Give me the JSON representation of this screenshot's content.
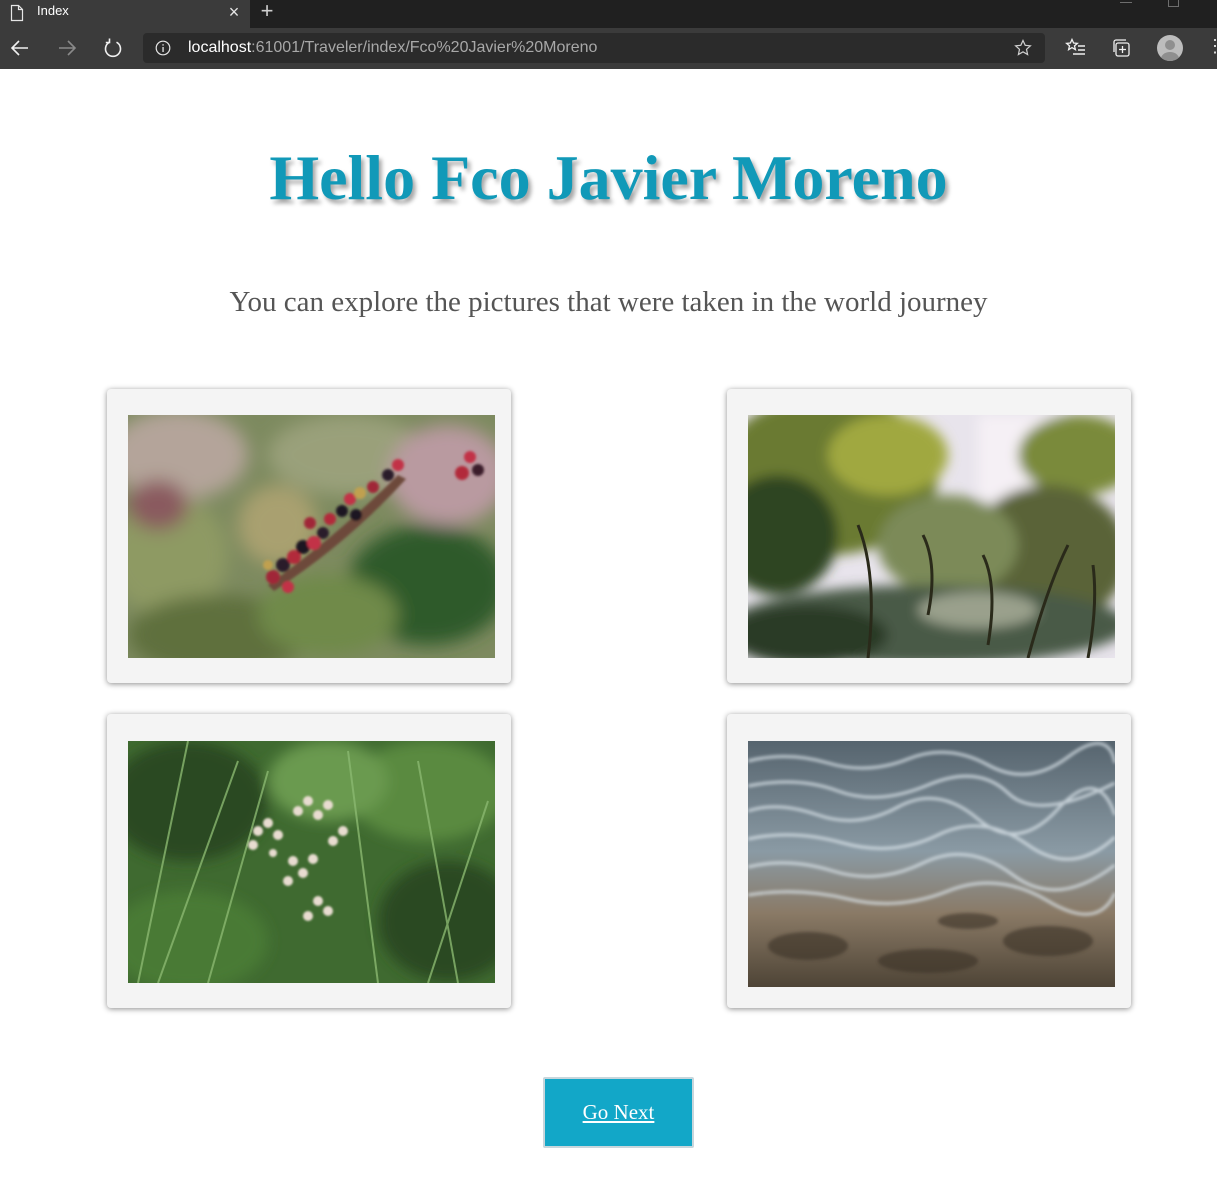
{
  "browser": {
    "tab_title": "Index",
    "tab_close": "×",
    "new_tab": "+",
    "url_host": "localhost",
    "url_rest": ":61001/Traveler/index/Fco%20Javier%20Moreno",
    "more": "⋮"
  },
  "page": {
    "title": "Hello Fco Javier Moreno",
    "subtitle": "You can explore the pictures that were taken in the world journey",
    "photos": [
      {
        "subject": "blackberries"
      },
      {
        "subject": "trees-in-sunlight"
      },
      {
        "subject": "white-wildflowers"
      },
      {
        "subject": "rippling-water"
      }
    ],
    "go_next_label": "Go Next"
  },
  "colors": {
    "title": "#1199b8",
    "button": "#12a7c8",
    "subtitle": "#555555",
    "card": "#f4f4f4"
  }
}
